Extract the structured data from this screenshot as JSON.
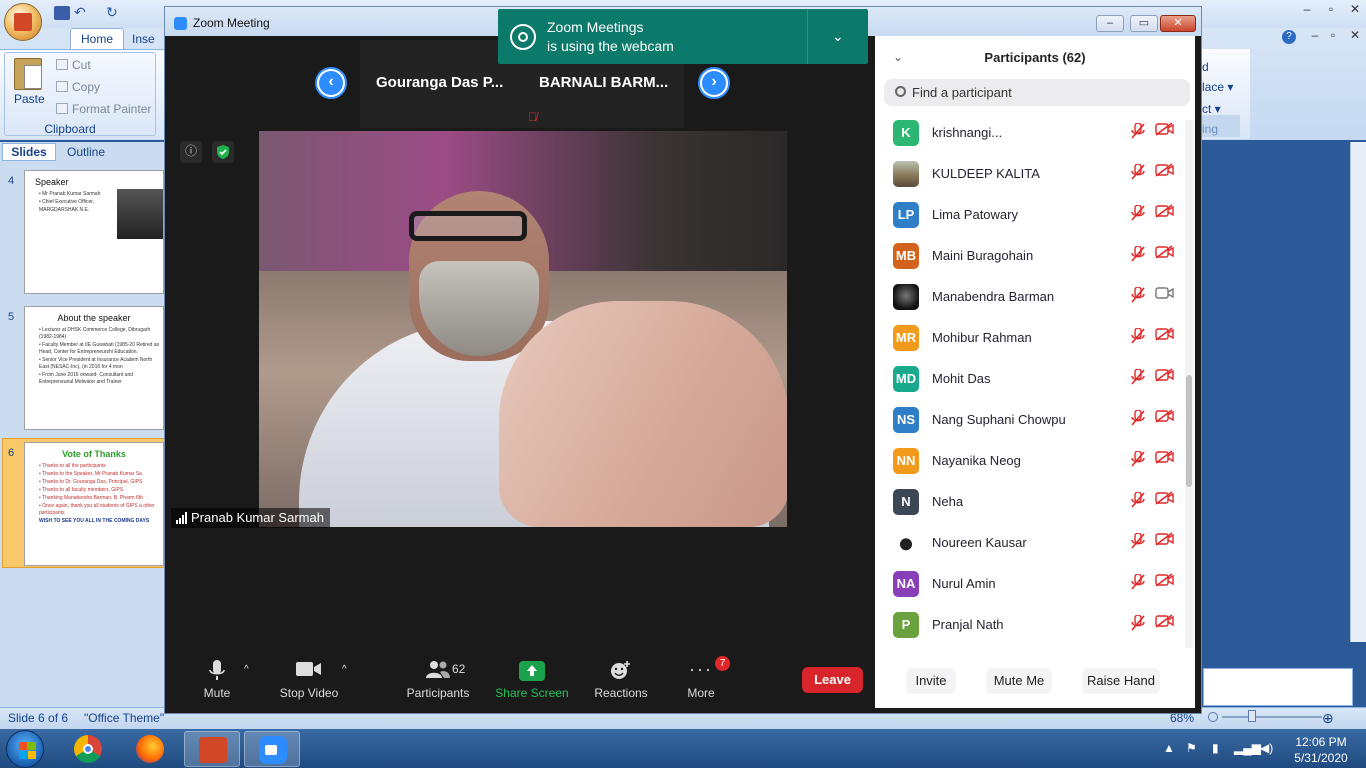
{
  "ppt": {
    "tabs": {
      "home": "Home",
      "insert": "Inse"
    },
    "clipboard": {
      "paste": "Paste",
      "cut": "Cut",
      "copy": "Copy",
      "format_painter": "Format Painter",
      "group_label": "Clipboard"
    },
    "right_ribbon": {
      "a": "d",
      "b": "lace ▾",
      "c": "ct ▾",
      "d": "ing"
    },
    "pane_tabs": {
      "slides": "Slides",
      "outline": "Outline"
    },
    "thumbs": [
      {
        "num": "4",
        "title": "Speaker",
        "lines": [
          "• Mr Pranab Kumar Sarmah",
          "• Chief Executive Officer,",
          "  MARGDARSHAK N.E."
        ]
      },
      {
        "num": "5",
        "title": "About the speaker",
        "lines": [
          "• Lecturer at DHSK Commerce College, Dibrugarh (1982-1984)",
          "• Faculty Member at IIE Guwahati (1985-20 Retired as Head, Center for Entrepreneurshi Education.",
          "• Senior Vice President at Insurance Academ North East (NESAC-Inc), (in 2016 for 4 mon",
          "• From June 2016 onward- Consultant and Entrepreneurial Motivator and Trainer"
        ]
      },
      {
        "num": "6",
        "title": "Vote of Thanks",
        "lines": [
          "• Thanks to all the participants",
          "• Thanks to the Speaker, Mr Pranab Kumar Sa",
          "• Thanks to Dr. Gouranga Das, Principal, GIPS",
          "• Thanks to all faculty members, GIPS",
          "• Thanking Manabendra Barman, B. Pharm 6th",
          "• Once again, thank you all students of GIPS a other participants",
          "WISH TO SEE YOU ALL IN THE COMING DAYS"
        ]
      }
    ],
    "status": {
      "slide": "Slide 6 of 6",
      "theme": "\"Office Theme\"",
      "zoom": "68%"
    }
  },
  "taskbar": {
    "time": "12:06 PM",
    "date": "5/31/2020"
  },
  "zoom": {
    "window_title": "Zoom Meeting",
    "toast": {
      "line1": "Zoom Meetings",
      "line2": "is using the webcam"
    },
    "gallery_names": [
      "Gouranga Das P...",
      "BARNALI BARM..."
    ],
    "active_speaker": "Pranab Kumar Sarmah",
    "toolbar": {
      "mute": "Mute",
      "stop_video": "Stop Video",
      "participants": "Participants",
      "participants_count": "62",
      "share_screen": "Share Screen",
      "reactions": "Reactions",
      "more": "More",
      "more_badge": "7",
      "leave": "Leave"
    },
    "colors": {
      "accent": "#2d8cff",
      "leave": "#d7252b",
      "share": "#1aa34a",
      "muted": "#e02828"
    },
    "panel": {
      "title": "Participants (62)",
      "search_placeholder": "Find a participant",
      "participants": [
        {
          "initials": "K",
          "name": "krishnangi...",
          "color": "#2bb673",
          "video": "off"
        },
        {
          "initials": "",
          "name": "KULDEEP KALITA",
          "color": "#a08a5a",
          "video": "off",
          "photo": true
        },
        {
          "initials": "LP",
          "name": "Lima Patowary",
          "color": "#2f7fc8",
          "video": "off"
        },
        {
          "initials": "MB",
          "name": "Maini Buragohain",
          "color": "#d2631c",
          "video": "off"
        },
        {
          "initials": "",
          "name": "Manabendra Barman",
          "color": "#222222",
          "video": "on",
          "photo": true
        },
        {
          "initials": "MR",
          "name": "Mohibur Rahman",
          "color": "#f29a1b",
          "video": "off"
        },
        {
          "initials": "MD",
          "name": "Mohit Das",
          "color": "#19a98c",
          "video": "off"
        },
        {
          "initials": "NS",
          "name": "Nang Suphani Chowpu",
          "color": "#2f7fc8",
          "video": "off"
        },
        {
          "initials": "NN",
          "name": "Nayanika Neog",
          "color": "#f29a1b",
          "video": "off"
        },
        {
          "initials": "N",
          "name": "Neha",
          "color": "#3b4656",
          "video": "off"
        },
        {
          "initials": "",
          "name": "Noureen Kausar",
          "color": "#ffffff",
          "video": "off",
          "photo": true
        },
        {
          "initials": "NA",
          "name": "Nurul Amin",
          "color": "#8a3fb8",
          "video": "off"
        },
        {
          "initials": "P",
          "name": "Pranjal Nath",
          "color": "#6aa33d",
          "video": "off"
        }
      ],
      "buttons": {
        "invite": "Invite",
        "mute_me": "Mute Me",
        "raise_hand": "Raise Hand"
      }
    }
  }
}
